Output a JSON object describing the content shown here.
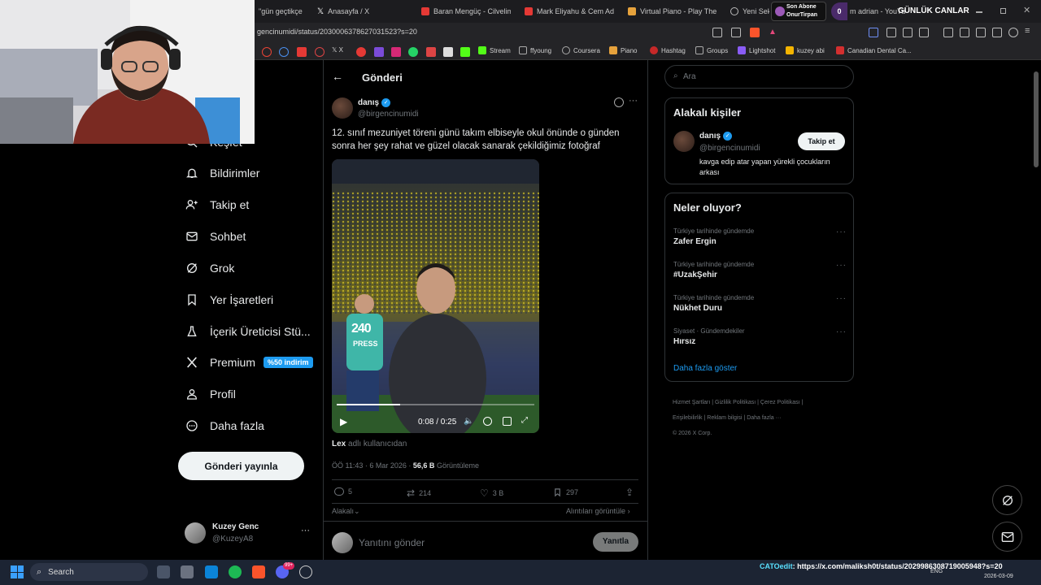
{
  "browser": {
    "tabs": [
      {
        "label": "\"gün geçtikçe"
      },
      {
        "label": "Anasayfa / X"
      },
      {
        "label": "Baran Mengüç - Cilvelim"
      },
      {
        "label": "Mark Eliyahu & Cem Adria"
      },
      {
        "label": "Virtual Piano - Play The B"
      },
      {
        "label": "Yeni Sek"
      },
      {
        "label": "m adrian - YouTu"
      }
    ],
    "url": "gencinumidi/status/2030006378627031523?s=20",
    "bookmarks": [
      {
        "label": "Stream"
      },
      {
        "label": "ffyoung"
      },
      {
        "label": "Coursera"
      },
      {
        "label": "Piano"
      },
      {
        "label": "Hashtag"
      },
      {
        "label": "Groups"
      },
      {
        "label": "Lightshot"
      },
      {
        "label": "kuzey abi"
      },
      {
        "label": "Canadian Dental Ca..."
      }
    ]
  },
  "overlay": {
    "sub_count": "0",
    "sub_title": "Son Abone",
    "sub_name": "OnurTirpan",
    "banner": "GÜNLÜK CANLAR",
    "chat_user": "CATOedit",
    "chat_msg": ": https://x.com/maliksh0t/status/2029986308719005948?s=20"
  },
  "nav": {
    "items": [
      {
        "label": "Keşfet"
      },
      {
        "label": "Bildirimler"
      },
      {
        "label": "Takip et"
      },
      {
        "label": "Sohbet"
      },
      {
        "label": "Grok"
      },
      {
        "label": "Yer İşaretleri"
      },
      {
        "label": "İçerik Üreticisi Stü..."
      },
      {
        "label": "Premium"
      },
      {
        "label": "Profil"
      },
      {
        "label": "Daha fazla"
      }
    ],
    "premium_badge": "%50 indirim",
    "post_button": "Gönderi yayınla",
    "account_name": "Kuzey Genc",
    "account_handle": "@KuzeyA8"
  },
  "main": {
    "header_title": "Gönderi",
    "author_name": "danış",
    "author_handle": "@birgencinumidi",
    "text": "12. sınıf mezuniyet töreni günü takım elbiseyle okul önünde o günden sonra her şey rahat ve güzel olacak sanarak çekildiğimiz fotoğraf",
    "video": {
      "time": "0:08 / 0:25",
      "progress": 0.32,
      "bib_number": "240",
      "bib_text": "PRESS"
    },
    "from_user": "Lex",
    "from_suffix": "adlı kullanıcıdan",
    "meta_time": "ÖÖ 11:43 · 6 Mar 2026 ·",
    "views_count": "56,6 B",
    "views_label": "Görüntüleme",
    "stats": {
      "replies": "5",
      "reposts": "214",
      "likes": "3 B",
      "bookmarks": "297"
    },
    "sort_label": "Alakalı",
    "quotes_label": "Alıntıları görüntüle",
    "reply_placeholder": "Yanıtını gönder",
    "reply_button": "Yanıtla"
  },
  "sidebar": {
    "search_placeholder": "Ara",
    "related_title": "Alakalı kişiler",
    "related": {
      "name": "danış",
      "handle": "@birgencinumidi",
      "bio": "kavga edip atar yapan yürekli çocukların arkası",
      "follow": "Takip et"
    },
    "trends_title": "Neler oluyor?",
    "trends": [
      {
        "cat": "Türkiye tarihinde gündemde",
        "name": "Zafer Ergin"
      },
      {
        "cat": "Türkiye tarihinde gündemde",
        "name": "#UzakŞehir"
      },
      {
        "cat": "Türkiye tarihinde gündemde",
        "name": "Nükhet Duru"
      },
      {
        "cat": "Siyaset · Gündemdekiler",
        "name": "Hırsız"
      }
    ],
    "show_more": "Daha fazla göster",
    "footer": {
      "l1": "Hizmet Şartları",
      "l2": "Gizlilik Politikası",
      "l3": "Çerez Politikası",
      "l4": "Erişilebilirlik",
      "l5": "Reklam bilgisi",
      "l6": "Daha fazla ···",
      "copy": "© 2026 X Corp."
    }
  },
  "taskbar": {
    "search": "Search",
    "lang": "ENG",
    "date": "2026-03-09",
    "chat_badge": "99+"
  },
  "colors": {
    "accent": "#1d9bf0",
    "bg": "#000000",
    "border": "#2f3336",
    "muted": "#71767b"
  }
}
